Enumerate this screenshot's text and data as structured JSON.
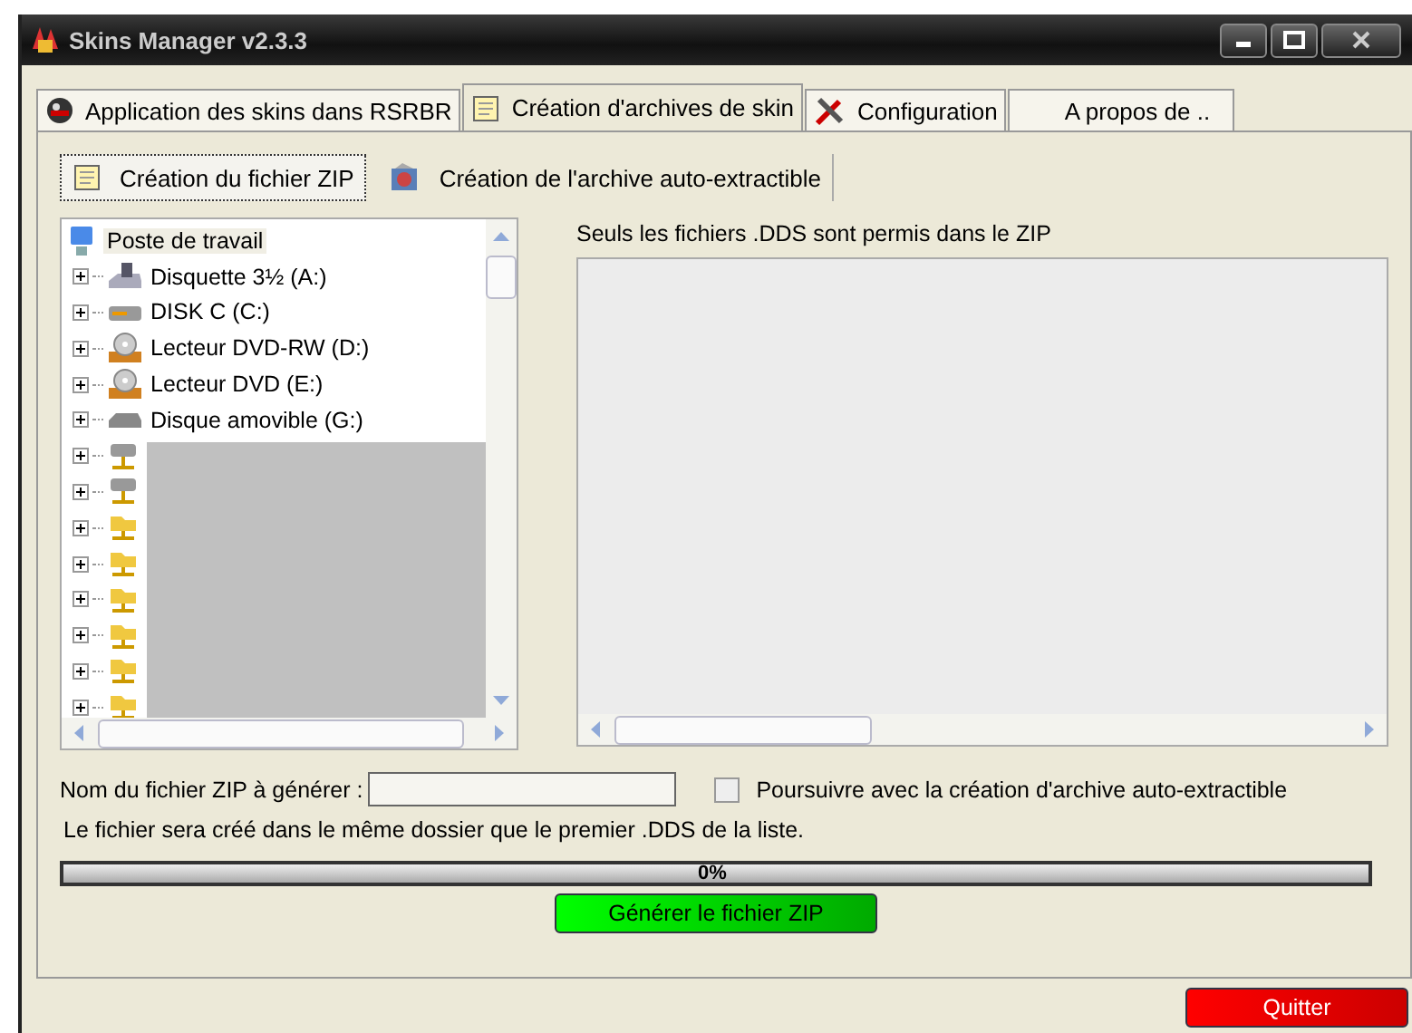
{
  "window": {
    "title": "Skins Manager v2.3.3"
  },
  "tabs": [
    {
      "label": "Application des skins dans RSRBR",
      "selected": false
    },
    {
      "label": "Création d'archives de skin",
      "selected": true
    },
    {
      "label": "Configuration",
      "selected": false
    },
    {
      "label": "A propos de ..",
      "selected": false
    }
  ],
  "subtabs": [
    {
      "label": "Création du fichier ZIP",
      "selected": true
    },
    {
      "label": "Création de l'archive auto-extractible",
      "selected": false
    }
  ],
  "tree": {
    "root": {
      "label": "Poste de travail",
      "kind": "computer",
      "selected": true
    },
    "children": [
      {
        "label": "Disquette 3½ (A:)",
        "kind": "floppy",
        "expanded": false
      },
      {
        "label": "DISK C (C:)",
        "kind": "disk",
        "expanded": false
      },
      {
        "label": "Lecteur DVD-RW (D:)",
        "kind": "dvd",
        "expanded": false
      },
      {
        "label": "Lecteur DVD (E:)",
        "kind": "dvd",
        "expanded": false
      },
      {
        "label": "Disque amovible (G:)",
        "kind": "removable",
        "expanded": false
      },
      {
        "kind": "network",
        "expanded": false
      },
      {
        "kind": "network",
        "expanded": false
      },
      {
        "kind": "folder",
        "expanded": false
      },
      {
        "kind": "folder",
        "expanded": false
      },
      {
        "kind": "folder",
        "expanded": false
      },
      {
        "kind": "folder",
        "expanded": false
      },
      {
        "kind": "folder",
        "expanded": false
      },
      {
        "kind": "folder",
        "expanded": false
      }
    ]
  },
  "file_list": {
    "label": "Seuls les fichiers .DDS sont permis dans le ZIP"
  },
  "zip_name": {
    "label": "Nom du fichier ZIP à générer :"
  },
  "continue_checkbox": {
    "label": "Poursuivre avec la création d'archive auto-extractible",
    "checked": false
  },
  "note": "Le fichier sera créé dans le même dossier que le premier .DDS de la liste.",
  "progress": {
    "level": 0,
    "reading": "0%"
  },
  "generate_button": "Générer le fichier ZIP",
  "quit_button": "Quitter"
}
